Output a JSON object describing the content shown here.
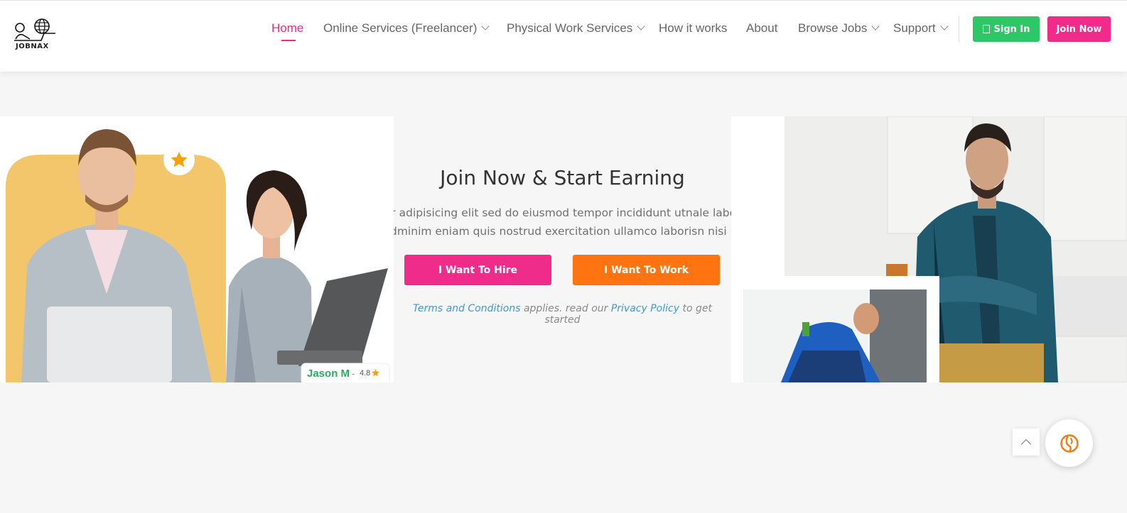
{
  "brand": {
    "logo_text": "JOBNAX",
    "accent_pink": "#e8307f",
    "accent_green": "#2ec768",
    "accent_orange": "#ff7410"
  },
  "nav": {
    "items": [
      {
        "label": "Home",
        "active": true,
        "has_dropdown": false
      },
      {
        "label": "Online Services (Freelancer)",
        "active": false,
        "has_dropdown": true
      },
      {
        "label": "Physical Work Services",
        "active": false,
        "has_dropdown": true
      },
      {
        "label": "How it works",
        "active": false,
        "has_dropdown": false
      },
      {
        "label": "About",
        "active": false,
        "has_dropdown": false
      },
      {
        "label": "Browse Jobs",
        "active": false,
        "has_dropdown": true
      },
      {
        "label": "Support",
        "active": false,
        "has_dropdown": true
      }
    ],
    "signin_label": "Sign In",
    "join_label": "Join Now"
  },
  "hero": {
    "title": "Join Now & Start Earning",
    "desc_line1": "ur adipisicing elit sed do eiusmod tempor incididunt utnale labor",
    "desc_line2": "adminim eniam quis nostrud exercitation ullamco laborisn nisi ut",
    "hire_label": "I Want To Hire",
    "work_label": "I Want To Work",
    "note_link1": "Terms and Conditions",
    "note_mid": " applies. read our ",
    "note_link2": "Privacy Policy",
    "note_end": " to get started",
    "rating_card": {
      "name": "Jason M",
      "sep": "-",
      "rating": "4.8"
    }
  },
  "icons": {
    "star": "star-icon",
    "scroll_top": "chevron-up-icon",
    "chat": "chat-icon",
    "signin": "login-icon"
  }
}
